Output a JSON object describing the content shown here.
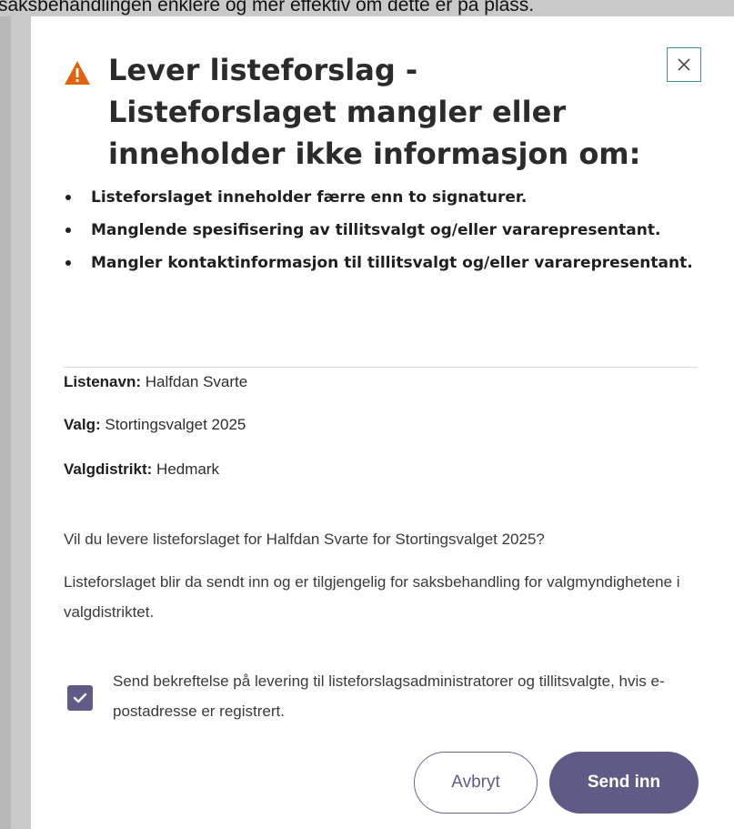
{
  "background": {
    "text": "saksbehandlingen enklere og mer effektiv om dette er på plass."
  },
  "dialog": {
    "title": "Lever listeforslag - Listeforslaget mangler eller inneholder ikke informasjon om:",
    "warning_icon": "warning-triangle-icon",
    "close_icon": "close-icon",
    "bullets": [
      "Listeforslaget inneholder færre enn to signaturer.",
      "Manglende spesifisering av tillitsvalgt og/eller vararepresentant.",
      "Mangler kontaktinformasjon til tillitsvalgt og/eller vararepresentant."
    ],
    "info": {
      "list_name_label": "Listenavn:",
      "list_name_value": "Halfdan Svarte",
      "election_label": "Valg:",
      "election_value": "Stortingsvalget 2025",
      "district_label": "Valgdistrikt:",
      "district_value": "Hedmark"
    },
    "question": "Vil du levere listeforslaget for Halfdan Svarte for Stortingsvalget 2025?",
    "explanation": "Listeforslaget blir da sendt inn og er tilgjengelig for saksbehandling for valgmyndighetene i valgdistriktet.",
    "checkbox": {
      "checked": true,
      "label": "Send bekreftelse på levering til listeforslagsadministratorer og tillitsvalgte, hvis e-postadresse er registrert."
    },
    "buttons": {
      "cancel": "Avbryt",
      "submit": "Send inn"
    }
  },
  "colors": {
    "accent": "#5f5a86",
    "warning": "#e0640f",
    "close_border": "#4a8a9a"
  }
}
